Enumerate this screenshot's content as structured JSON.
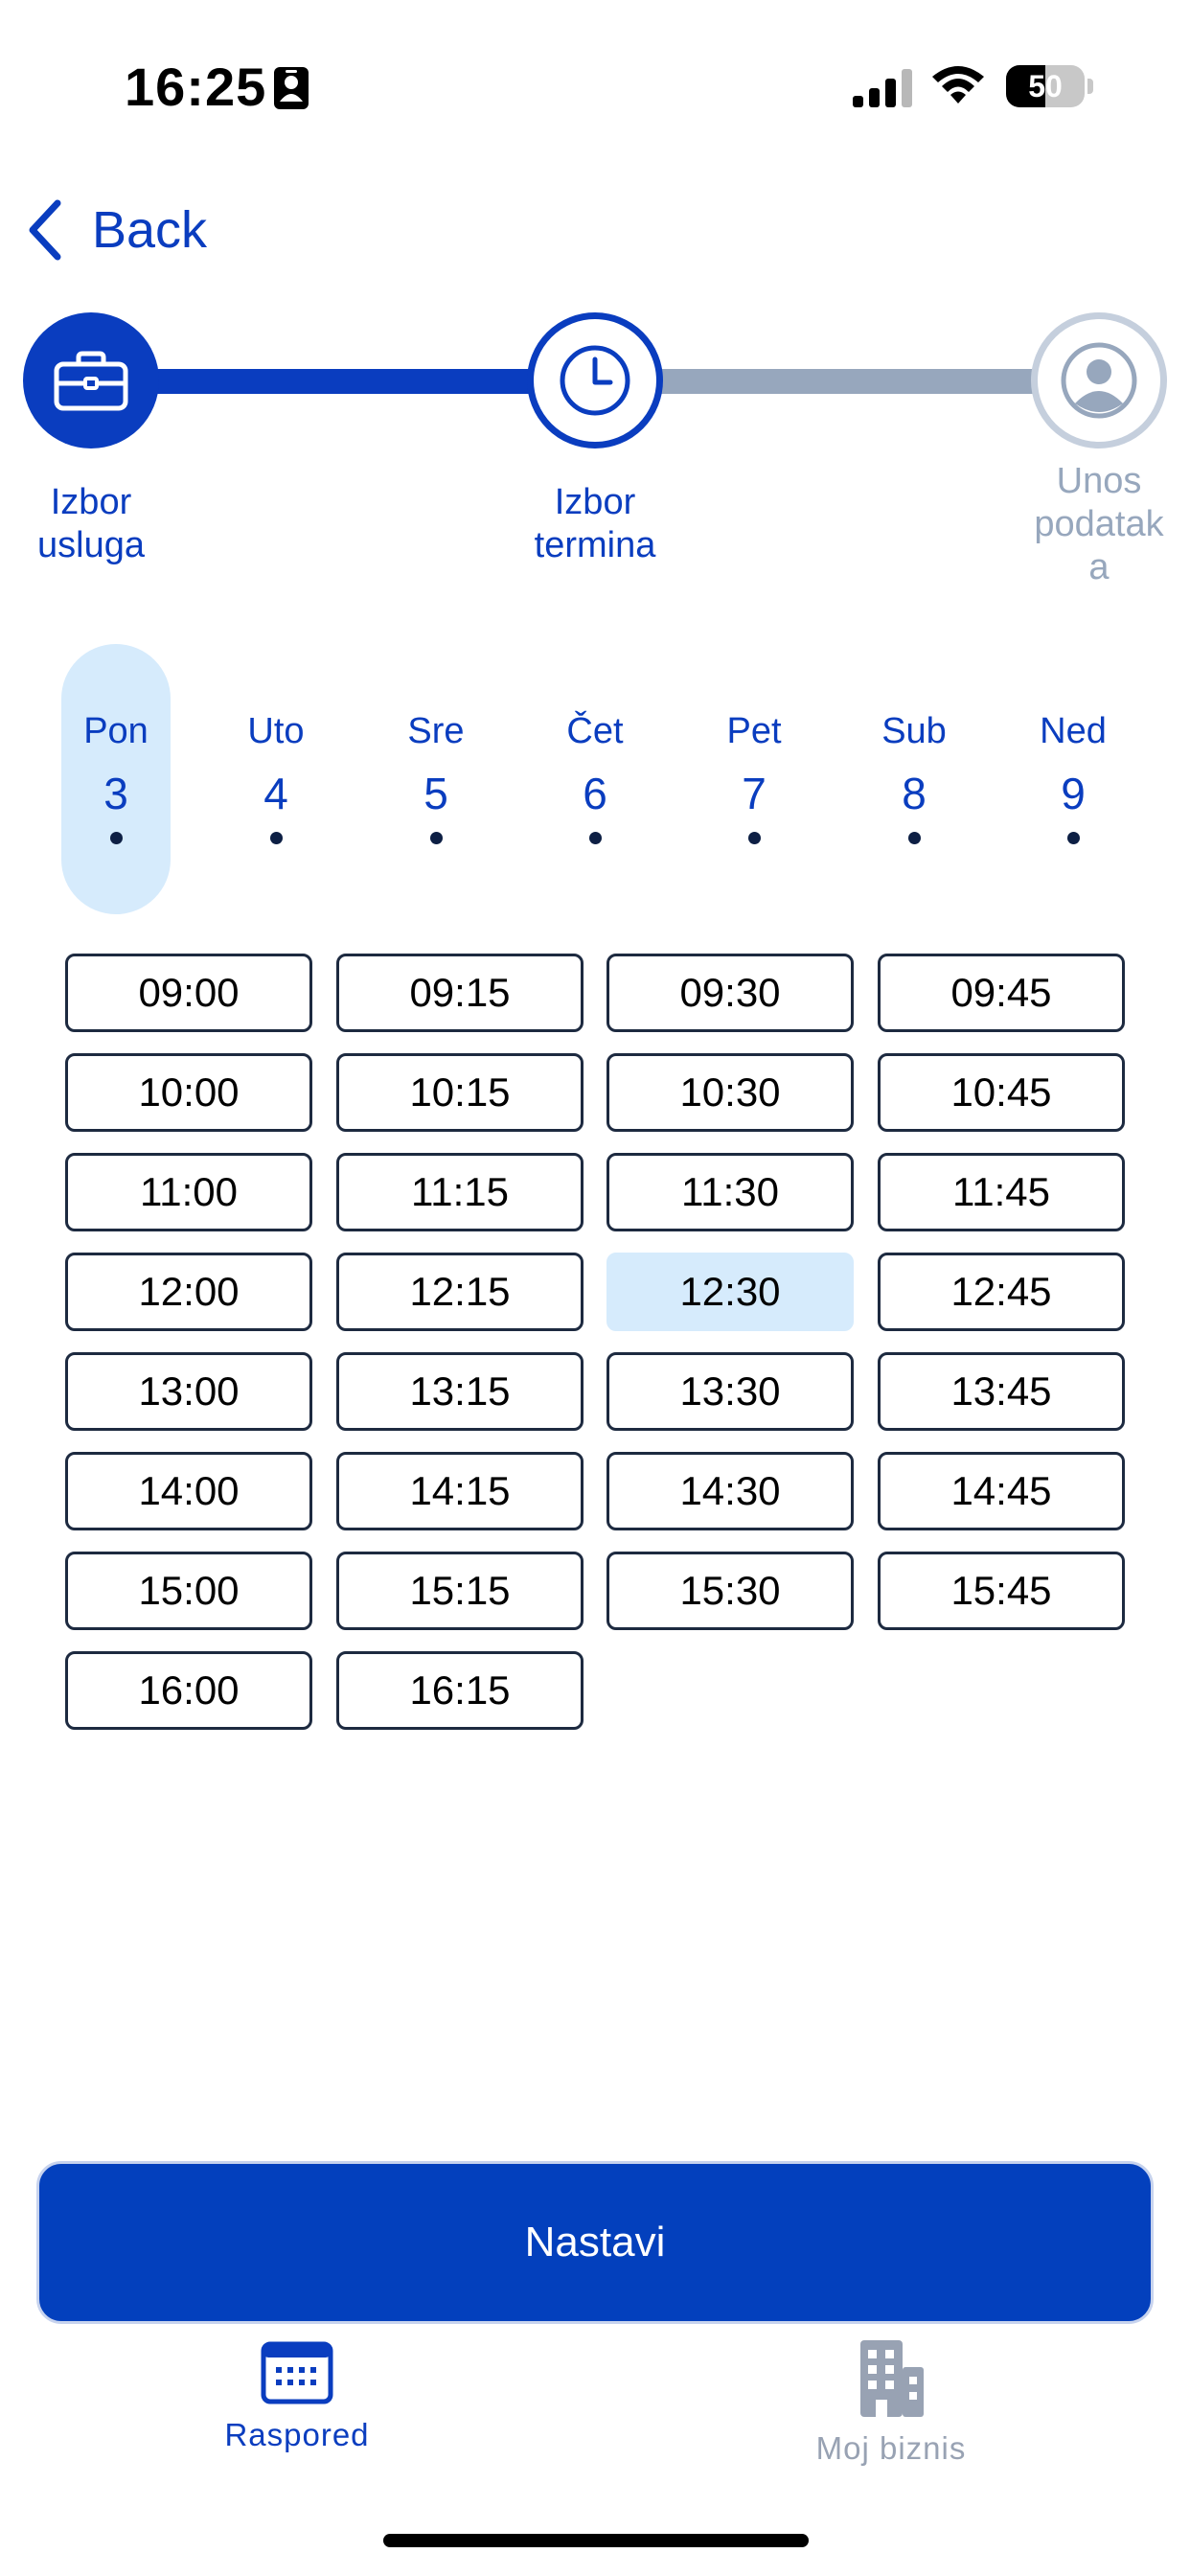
{
  "status_bar": {
    "time": "16:25",
    "battery_percent": "50",
    "battery_level": 0.5,
    "icons": [
      "contact-card-icon",
      "cellular-signal-icon",
      "wifi-icon",
      "battery-icon"
    ]
  },
  "nav": {
    "back_label": "Back",
    "back_icon": "chevron-left-icon"
  },
  "stepper": {
    "steps": [
      {
        "label_line1": "Izbor",
        "label_line2": "usluga",
        "label_line3": "",
        "icon": "briefcase-icon",
        "state": "done"
      },
      {
        "label_line1": "Izbor",
        "label_line2": "termina",
        "label_line3": "",
        "icon": "clock-icon",
        "state": "active"
      },
      {
        "label_line1": "Unos",
        "label_line2": "podatak",
        "label_line3": "a",
        "icon": "user-icon",
        "state": "pending"
      }
    ]
  },
  "days": [
    {
      "name": "Pon",
      "num": "3",
      "selected": true
    },
    {
      "name": "Uto",
      "num": "4",
      "selected": false
    },
    {
      "name": "Sre",
      "num": "5",
      "selected": false
    },
    {
      "name": "Čet",
      "num": "6",
      "selected": false
    },
    {
      "name": "Pet",
      "num": "7",
      "selected": false
    },
    {
      "name": "Sub",
      "num": "8",
      "selected": false
    },
    {
      "name": "Ned",
      "num": "9",
      "selected": false
    }
  ],
  "time_slots": [
    "09:00",
    "09:15",
    "09:30",
    "09:45",
    "10:00",
    "10:15",
    "10:30",
    "10:45",
    "11:00",
    "11:15",
    "11:30",
    "11:45",
    "12:00",
    "12:15",
    "12:30",
    "12:45",
    "13:00",
    "13:15",
    "13:30",
    "13:45",
    "14:00",
    "14:15",
    "14:30",
    "14:45",
    "15:00",
    "15:15",
    "15:30",
    "15:45",
    "16:00",
    "16:15"
  ],
  "selected_slot": "12:30",
  "continue_label": "Nastavi",
  "tab_bar": {
    "tabs": [
      {
        "label": "Raspored",
        "icon": "calendar-icon",
        "active": true
      },
      {
        "label": "Moj biznis",
        "icon": "building-icon",
        "active": false
      }
    ]
  },
  "colors": {
    "primary": "#0A3DBF",
    "selected_bg": "#D6EBFC",
    "inactive": "#97A7BD",
    "slot_border": "#1D2A40"
  }
}
